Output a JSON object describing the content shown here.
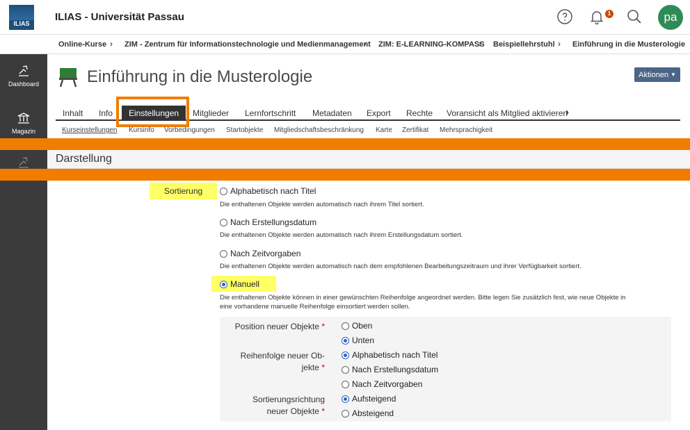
{
  "header": {
    "logo_text": "ILIAS",
    "title": "ILIAS - Universität Passau",
    "notification_count": "1",
    "avatar_initials": "pa"
  },
  "breadcrumb": [
    "Online-Kurse",
    "ZIM - Zentrum für Informationstechnologie und Medienmanagement",
    "ZIM: E-LEARNING-KOMPASS",
    "Beispiellehrstuhl",
    "Einführung in die Musterologie"
  ],
  "sidebar": {
    "items": [
      {
        "label": "Dashboard",
        "icon": "dashboard-icon"
      },
      {
        "label": "Magazin",
        "icon": "repository-icon"
      }
    ]
  },
  "page": {
    "title": "Einführung in die Musterologie",
    "actions_label": "Aktionen"
  },
  "tabs": [
    "Inhalt",
    "Info",
    "Einstellungen",
    "Mitglieder",
    "Lernfortschritt",
    "Metadaten",
    "Export",
    "Rechte",
    "Voransicht als Mitglied aktivieren"
  ],
  "subtabs": [
    "Kurseinstellungen",
    "Kursinfo",
    "Vorbedingungen",
    "Startobjekte",
    "Mitgliedschaftsbeschränkung",
    "Karte",
    "Zertifikat",
    "Mehrsprachigkeit"
  ],
  "section": {
    "title": "Darstellung"
  },
  "form": {
    "sort_label": "Sortierung",
    "options": [
      {
        "label": "Alphabetisch nach Titel",
        "desc": "Die enthaltenen Objekte werden automatisch nach ihrem Titel sortiert."
      },
      {
        "label": "Nach Erstellungsdatum",
        "desc": "Die enthaltenen Objekte werden automatisch nach ihrem Erstellungsdatum sortiert."
      },
      {
        "label": "Nach Zeitvorgaben",
        "desc": "Die enthaltenen Objekte werden automatisch nach dem empfohlenen Bearbeitungszeitraum und ihrer Verfügbarkeit sortiert."
      },
      {
        "label": "Manuell",
        "desc1": "Die enthaltenen Objekte können in einer gewünschten Reihenfolge angeordnet werden. Bitte legen Sie zusätzlich fest, wie neue Objekte in",
        "desc2": "eine vorhandene manuelle Reihenfolge einsortiert werden sollen."
      }
    ],
    "position_label": "Position neuer Objekte",
    "position_options": [
      "Oben",
      "Unten"
    ],
    "order_label1": "Reihenfolge neuer Ob-",
    "order_label2": "jekte",
    "order_options": [
      "Alphabetisch nach Titel",
      "Nach Erstellungsdatum",
      "Nach Zeitvorgaben"
    ],
    "direction_label1": "Sortierungsrichtung",
    "direction_label2": "neuer Objekte",
    "direction_options": [
      "Aufsteigend",
      "Absteigend"
    ],
    "required_mark": "*"
  }
}
